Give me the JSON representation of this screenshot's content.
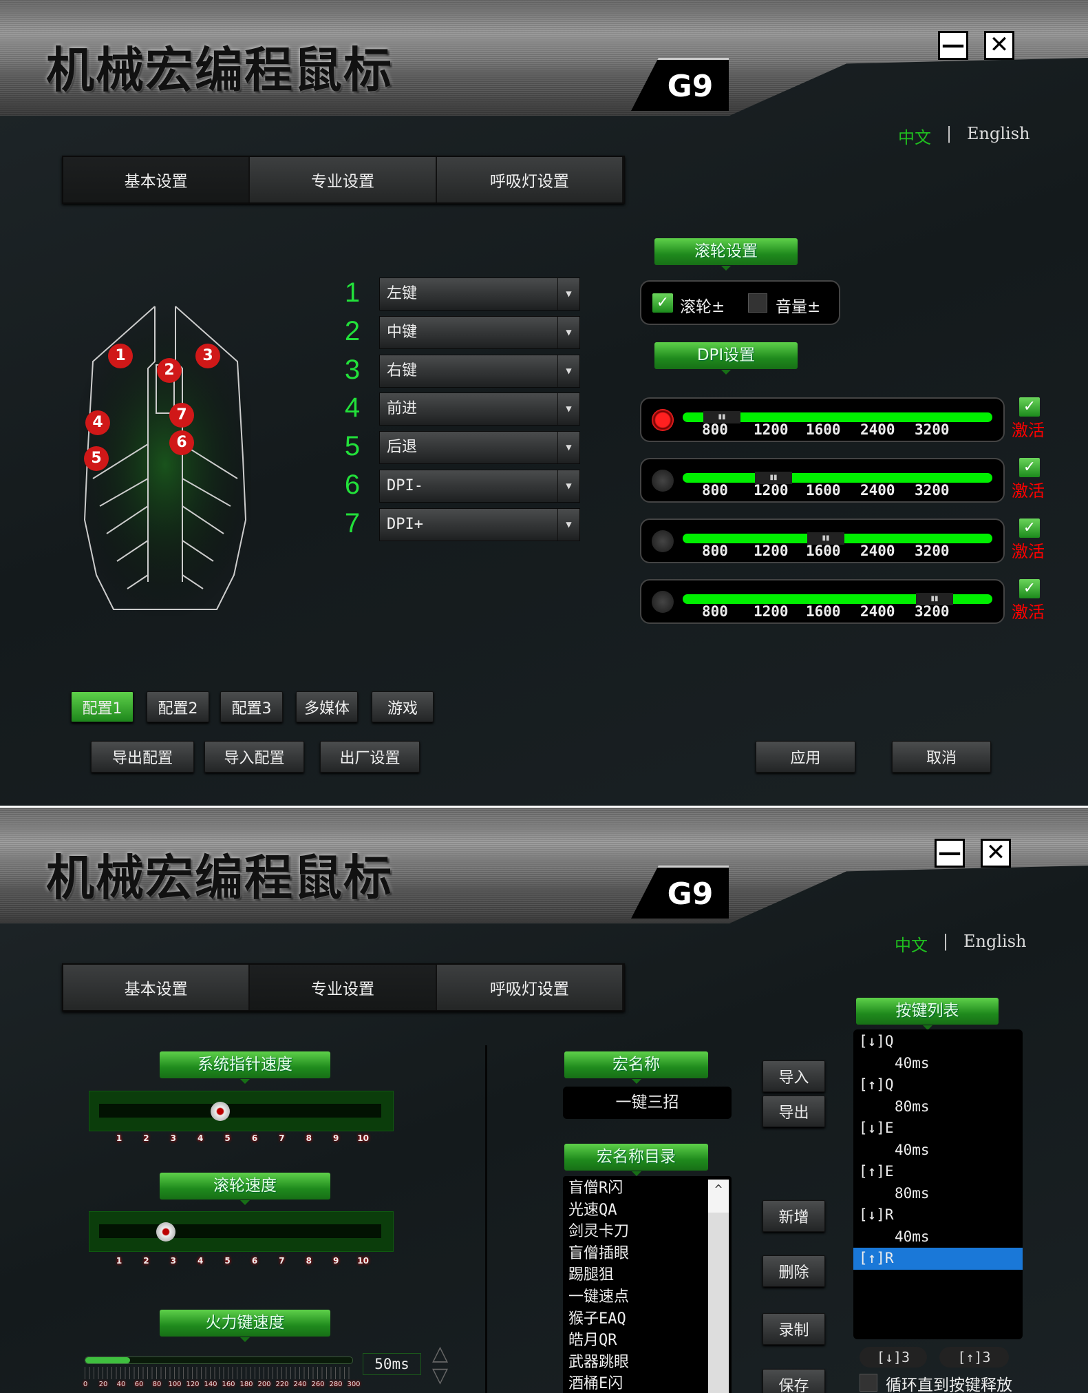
{
  "app": {
    "title": "机械宏编程鼠标",
    "model": "G9",
    "minimize": "—",
    "close": "✕",
    "lang_zh": "中文",
    "lang_sep": "|",
    "lang_en": "English"
  },
  "tabs": [
    "基本设置",
    "专业设置",
    "呼吸灯设置"
  ],
  "basic": {
    "buttons": [
      {
        "num": "1",
        "value": "左键"
      },
      {
        "num": "2",
        "value": "中键"
      },
      {
        "num": "3",
        "value": "右键"
      },
      {
        "num": "4",
        "value": "前进"
      },
      {
        "num": "5",
        "value": "后退"
      },
      {
        "num": "6",
        "value": "DPI-"
      },
      {
        "num": "7",
        "value": "DPI+"
      }
    ],
    "mouse_markers": [
      "1",
      "2",
      "3",
      "4",
      "5",
      "6",
      "7"
    ],
    "wheel": {
      "header": "滚轮设置",
      "wheel_label": "滚轮±",
      "wheel_checked": true,
      "volume_label": "音量±",
      "volume_checked": false
    },
    "dpi": {
      "header": "DPI设置",
      "levels": [
        "800",
        "1200",
        "1600",
        "2400",
        "3200"
      ],
      "active_label": "激活",
      "rows": [
        {
          "selected": true,
          "value": "800",
          "active": true
        },
        {
          "selected": false,
          "value": "1200",
          "active": true
        },
        {
          "selected": false,
          "value": "1600",
          "active": true
        },
        {
          "selected": false,
          "value": "3200",
          "active": true
        }
      ]
    },
    "profiles": [
      "配置1",
      "配置2",
      "配置3",
      "多媒体",
      "游戏"
    ],
    "active_profile": "配置1",
    "actions": [
      "导出配置",
      "导入配置",
      "出厂设置"
    ],
    "apply": "应用",
    "cancel": "取消"
  },
  "pro": {
    "pointer_speed": {
      "header": "系统指针速度",
      "value": 5,
      "ticks": [
        "1",
        "2",
        "3",
        "4",
        "5",
        "6",
        "7",
        "8",
        "9",
        "10"
      ]
    },
    "wheel_speed": {
      "header": "滚轮速度",
      "value": 3,
      "ticks": [
        "1",
        "2",
        "3",
        "4",
        "5",
        "6",
        "7",
        "8",
        "9",
        "10"
      ]
    },
    "fire_speed": {
      "header": "火力键速度",
      "value": 50,
      "display": "50ms",
      "max": 300,
      "ticks": [
        "0",
        "20",
        "40",
        "60",
        "80",
        "100",
        "120",
        "140",
        "160",
        "180",
        "200",
        "220",
        "240",
        "260",
        "280",
        "300"
      ]
    },
    "macro_name": {
      "header": "宏名称",
      "value": "一键三招"
    },
    "macro_dir": {
      "header": "宏名称目录",
      "items": [
        "盲僧R闪",
        "光速QA",
        "剑灵卡刀",
        "盲僧插眼",
        "踢腿狙",
        "一键速点",
        "猴子EAQ",
        "皓月QR",
        "武器跳眼",
        "酒桶E闪"
      ]
    },
    "buttons": {
      "import": "导入",
      "export": "导出",
      "add": "新增",
      "delete": "删除",
      "record": "录制",
      "save": "保存"
    },
    "key_list": {
      "header": "按键列表",
      "items": [
        {
          "t": "[↓]Q",
          "d": false
        },
        {
          "t": "40ms",
          "d": true
        },
        {
          "t": "[↑]Q",
          "d": false
        },
        {
          "t": "80ms",
          "d": true
        },
        {
          "t": "[↓]E",
          "d": false
        },
        {
          "t": "40ms",
          "d": true
        },
        {
          "t": "[↑]E",
          "d": false
        },
        {
          "t": "80ms",
          "d": true
        },
        {
          "t": "[↓]R",
          "d": false
        },
        {
          "t": "40ms",
          "d": true
        },
        {
          "t": "[↑]R",
          "d": false,
          "sel": true
        }
      ],
      "down_count": "[↓]3",
      "up_count": "[↑]3",
      "loop_label": "循环直到按键释放",
      "loop_checked": false
    }
  },
  "colors": {
    "accent_green": "#22e03a",
    "active_red": "#ff0000",
    "selection_blue": "#1a78d8"
  }
}
